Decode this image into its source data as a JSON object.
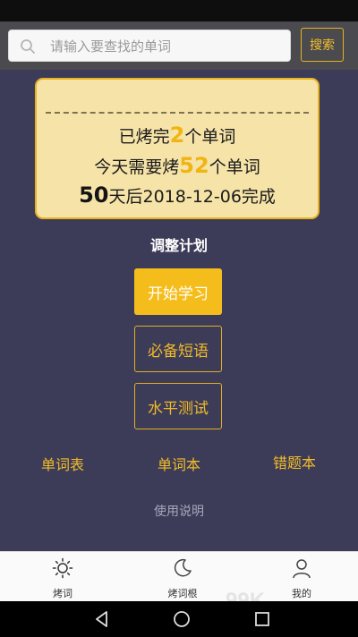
{
  "search": {
    "placeholder": "请输入要查找的单词",
    "button_label": "搜索"
  },
  "progress": {
    "baked_prefix": "已烤完",
    "baked_count": "2",
    "baked_suffix": "个单词",
    "daily_prefix": "今天需要烤",
    "daily_count": "52",
    "daily_suffix": "个单词",
    "days_left": "50",
    "finish_text": "天后2018-12-06完成"
  },
  "adjust_plan_label": "调整计划",
  "actions": {
    "start_label": "开始学习",
    "phrases_label": "必备短语",
    "test_label": "水平测试"
  },
  "links": {
    "word_list": "单词表",
    "word_book": "单词本",
    "wrong_book": "错题本"
  },
  "guide_label": "使用说明",
  "tabs": [
    {
      "label": "烤词",
      "icon": "sun-icon"
    },
    {
      "label": "烤词根",
      "icon": "moon-icon"
    },
    {
      "label": "我的",
      "icon": "person-icon"
    }
  ],
  "watermark": "99K",
  "colors": {
    "accent": "#f5bd1b",
    "background": "#3d3c58",
    "ticket": "#f6e3a8"
  }
}
